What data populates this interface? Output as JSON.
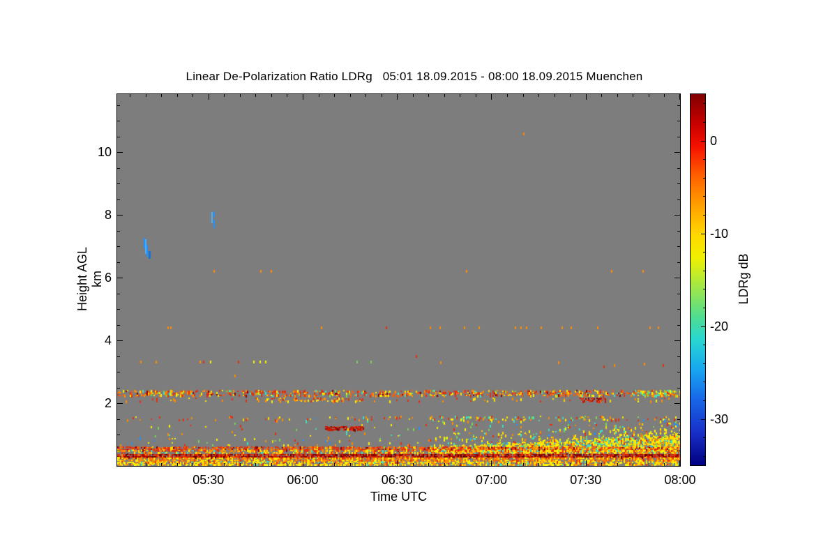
{
  "title": "Linear De-Polarization Ratio LDRg   05:01 18.09.2015 - 08:00 18.09.2015 Muenchen",
  "plot_bg": "#7d7d7d",
  "axes": {
    "x": {
      "label": "Time UTC",
      "start": "05:01",
      "end": "08:00",
      "tick_labels": [
        "05:30",
        "06:00",
        "06:30",
        "07:00",
        "07:30",
        "08:00"
      ],
      "tick_minutes": [
        30,
        60,
        90,
        120,
        150,
        180
      ],
      "minor_step_min": 5
    },
    "y": {
      "label": "Height AGL km",
      "tick_labels": [
        "2",
        "4",
        "6",
        "8",
        "10"
      ],
      "tick_km": [
        2,
        4,
        6,
        8,
        10
      ],
      "minor_step_km": 0.5,
      "range_km": [
        0,
        11.84
      ]
    }
  },
  "colorbar": {
    "label": "LDRg dB",
    "tick_labels": [
      "0",
      "-10",
      "-20",
      "-30"
    ],
    "tick_values": [
      0,
      -10,
      -20,
      -30
    ],
    "minor_step_db": 2,
    "range_db": [
      5,
      -35
    ],
    "gradient": [
      [
        0.0,
        "#800000"
      ],
      [
        0.08,
        "#c80000"
      ],
      [
        0.14,
        "#f51000"
      ],
      [
        0.22,
        "#ff6000"
      ],
      [
        0.3,
        "#ffa000"
      ],
      [
        0.38,
        "#ffd800"
      ],
      [
        0.44,
        "#f0f000"
      ],
      [
        0.52,
        "#a0e848"
      ],
      [
        0.6,
        "#50dc90"
      ],
      [
        0.66,
        "#28d8d0"
      ],
      [
        0.74,
        "#18a8f0"
      ],
      [
        0.82,
        "#1868e8"
      ],
      [
        0.91,
        "#1830c8"
      ],
      [
        1.0,
        "#000080"
      ]
    ]
  },
  "chart_data": {
    "type": "heatmap",
    "title": "Linear De-Polarization Ratio LDRg",
    "site": "Muenchen",
    "time_span": "05:01 18.09.2015 - 08:00 18.09.2015 UTC",
    "x_unit": "minutes after 05:00 UTC",
    "x_range": [
      1,
      180
    ],
    "y_unit": "km AGL",
    "y_range": [
      0,
      11.84
    ],
    "z_unit": "LDRg dB",
    "z_range": [
      5,
      -35
    ],
    "background_means": "no signal (gray)",
    "colors": {
      "o": "#FF8C00",
      "r": "#E03010",
      "y": "#FFF000",
      "g": "#78D850",
      "b": "#1E90FF",
      "lb": "#4FB0F8",
      "mb": "#1273D8"
    },
    "palettes": {
      "aerosol_mix": {
        "#E03010": 0.28,
        "#F26010": 0.18,
        "#FF8C00": 0.18,
        "#FFD700": 0.12,
        "#FFF000": 0.08,
        "#8B0000": 0.05,
        "#40E0C0": 0.06,
        "#78D850": 0.05
      },
      "cool_mix": {
        "#40E0C0": 0.3,
        "#78D850": 0.25,
        "#FFF000": 0.25,
        "#FF8C00": 0.2
      },
      "warm": {
        "#E03010": 0.35,
        "#FF8C00": 0.3,
        "#FFD700": 0.2,
        "#FFF000": 0.15
      },
      "red_dark": {
        "#C81800": 0.5,
        "#8B0000": 0.3,
        "#E03010": 0.2
      },
      "multi": {
        "#FF8C00": 0.22,
        "#E03010": 0.18,
        "#FFF000": 0.2,
        "#78D850": 0.12,
        "#40E0C0": 0.14,
        "#1E90FF": 0.06,
        "#FFD700": 0.08
      },
      "yellow_mix": {
        "#FFF000": 0.34,
        "#FFE000": 0.16,
        "#FFD700": 0.12,
        "#FF8C00": 0.1,
        "#40E0C0": 0.12,
        "#78D850": 0.08,
        "#E03010": 0.05,
        "#20B8E8": 0.03
      },
      "red_band": {
        "#E03010": 0.4,
        "#F26010": 0.25,
        "#FF8C00": 0.2,
        "#8B0000": 0.07,
        "#FFD700": 0.08
      },
      "band_mix": {
        "#FFF000": 0.3,
        "#FF8C00": 0.25,
        "#E03010": 0.2,
        "#FFD700": 0.15,
        "#40E0C0": 0.1
      },
      "dark_red_band": {
        "#8B0000": 0.3,
        "#C81800": 0.3,
        "#E03010": 0.25,
        "#600000": 0.08,
        "#FF8C00": 0.07
      },
      "orange_band": {
        "#FF8C00": 0.35,
        "#F26010": 0.2,
        "#FFF000": 0.22,
        "#FFD700": 0.15,
        "#E03010": 0.08
      },
      "yellow_band": {
        "#FFF000": 0.38,
        "#FFD700": 0.2,
        "#FF8C00": 0.25,
        "#E03010": 0.1,
        "#40E0C0": 0.07
      }
    },
    "features": [
      {
        "kind": "dotline",
        "name": "aerosol layer 2.35 km",
        "t": [
          1,
          180
        ],
        "km": [
          2.27,
          2.42
        ],
        "density": 0.5,
        "palette": "aerosol_mix"
      },
      {
        "kind": "dotline",
        "name": "layer 2.35 km cool-colored tail",
        "t": [
          166,
          180
        ],
        "km": [
          2.27,
          2.42
        ],
        "density": 0.5,
        "palette": "cool_mix"
      },
      {
        "kind": "dotline",
        "name": "layer 2.1 km sparse",
        "t": [
          1,
          180
        ],
        "km": [
          2.07,
          2.18
        ],
        "density": 0.09,
        "palette": "warm"
      },
      {
        "kind": "dotline",
        "name": "layer 2.1 km mid segment",
        "t": [
          50,
          81
        ],
        "km": [
          2.07,
          2.18
        ],
        "density": 0.32,
        "palette": "warm"
      },
      {
        "kind": "dotline",
        "name": "layer 2.1 km red cluster",
        "t": [
          148,
          156
        ],
        "km": [
          2.07,
          2.18
        ],
        "density": 0.6,
        "palette": "red_dark"
      },
      {
        "kind": "dotline",
        "name": "layer 1.5 km sparse",
        "t": [
          1,
          180
        ],
        "km": [
          1.45,
          1.58
        ],
        "density": 0.09,
        "palette": "warm"
      },
      {
        "kind": "dotline",
        "name": "layer 1.5 km right multi",
        "t": [
          100,
          180
        ],
        "km": [
          1.45,
          1.58
        ],
        "density": 0.12,
        "palette": "multi"
      },
      {
        "kind": "dotline",
        "name": "red segment 1.2 km 06:07-06:19",
        "t": [
          67,
          79
        ],
        "km": [
          1.18,
          1.27
        ],
        "density": 0.85,
        "palette": "red_dark"
      },
      {
        "kind": "scatter",
        "name": "sparse specks 0.85-1.6 km early",
        "t": [
          1,
          100
        ],
        "km": [
          0.85,
          1.6
        ],
        "density": 0.022,
        "palette": "multi"
      },
      {
        "kind": "scatter",
        "name": "specks 0.9-1.6 km late",
        "t": [
          100,
          180
        ],
        "km": [
          0.9,
          1.6
        ],
        "density": 0.06,
        "palette": "multi"
      },
      {
        "kind": "scatter",
        "name": "specks 0.6-0.9 km early",
        "t": [
          1,
          100
        ],
        "km": [
          0.62,
          0.9
        ],
        "density": 0.05,
        "palette": "multi"
      },
      {
        "kind": "wedge",
        "name": "growing boundary layer after 06:40",
        "t": [
          100,
          180
        ],
        "km_top": [
          0.6,
          1.02
        ],
        "km_bot": [
          0.45,
          0.5
        ],
        "density": 0.88,
        "palette": "yellow_mix"
      },
      {
        "kind": "wedge",
        "name": "sparse top of growing layer",
        "t": [
          100,
          180
        ],
        "km_top": [
          0.9,
          1.4
        ],
        "km_bot": [
          0.6,
          1.02
        ],
        "density": 0.15,
        "palette": "yellow_mix"
      },
      {
        "kind": "dotline",
        "name": "surface band 0.53-0.62 km red",
        "t": [
          1,
          180
        ],
        "km": [
          0.53,
          0.62
        ],
        "density": 0.8,
        "palette": "red_band"
      },
      {
        "kind": "dotline",
        "name": "surface band 0.40-0.52 km mixed",
        "t": [
          1,
          180
        ],
        "km": [
          0.4,
          0.52
        ],
        "density": 0.45,
        "palette": "band_mix",
        "ramp": [
          1,
          1.6
        ]
      },
      {
        "kind": "dotline",
        "name": "surface band 0.29-0.39 km dark red",
        "t": [
          1,
          180
        ],
        "km": [
          0.29,
          0.39
        ],
        "density": 0.92,
        "palette": "dark_red_band"
      },
      {
        "kind": "dotline",
        "name": "surface band 0.16-0.28 km orange",
        "t": [
          1,
          180
        ],
        "km": [
          0.16,
          0.28
        ],
        "density": 0.85,
        "palette": "orange_band"
      },
      {
        "kind": "dotline",
        "name": "surface band 0.02-0.15 km yellow",
        "t": [
          1,
          180
        ],
        "km": [
          0.02,
          0.15
        ],
        "density": 0.8,
        "palette": "yellow_band"
      },
      {
        "kind": "points",
        "name": "isolated echoes",
        "pts": [
          [
            130,
            10.58,
            "o"
          ],
          [
            31.6,
            6.2,
            "o"
          ],
          [
            46.5,
            6.2,
            "o"
          ],
          [
            49.8,
            6.2,
            "o"
          ],
          [
            111.9,
            6.2,
            "o"
          ],
          [
            158.1,
            6.2,
            "o"
          ],
          [
            168,
            6.2,
            "o"
          ],
          [
            17,
            4.4,
            "o"
          ],
          [
            17.9,
            4.4,
            "o"
          ],
          [
            65.8,
            4.4,
            "o"
          ],
          [
            86.4,
            4.4,
            "r"
          ],
          [
            100.4,
            4.4,
            "o"
          ],
          [
            103.5,
            4.4,
            "o"
          ],
          [
            111.2,
            4.4,
            "o"
          ],
          [
            115.9,
            4.4,
            "o"
          ],
          [
            127.4,
            4.4,
            "o"
          ],
          [
            129.2,
            4.4,
            "o"
          ],
          [
            131,
            4.4,
            "o"
          ],
          [
            135.6,
            4.4,
            "o"
          ],
          [
            142.3,
            4.4,
            "o"
          ],
          [
            145.2,
            4.4,
            "o"
          ],
          [
            153.6,
            4.4,
            "o"
          ],
          [
            170.2,
            4.4,
            "o"
          ],
          [
            172.9,
            4.4,
            "o"
          ],
          [
            8.3,
            3.32,
            "o"
          ],
          [
            13.2,
            3.32,
            "o"
          ],
          [
            27.2,
            3.32,
            "o"
          ],
          [
            28.3,
            3.32,
            "r"
          ],
          [
            30.5,
            3.32,
            "y"
          ],
          [
            39.4,
            3.32,
            "r"
          ],
          [
            44.3,
            3.32,
            "y"
          ],
          [
            46.3,
            3.32,
            "y"
          ],
          [
            48,
            3.32,
            "y"
          ],
          [
            77.1,
            3.32,
            "g"
          ],
          [
            81.5,
            3.32,
            "g"
          ],
          [
            96,
            3.5,
            "r"
          ],
          [
            103.7,
            3.3,
            "o"
          ],
          [
            141.2,
            3.3,
            "o"
          ],
          [
            155.6,
            3.15,
            "r"
          ],
          [
            159,
            3.2,
            "o"
          ],
          [
            168.5,
            3.25,
            "o"
          ],
          [
            174.5,
            3.2,
            "r"
          ],
          [
            38.2,
            2.87,
            "o"
          ]
        ]
      },
      {
        "kind": "rects",
        "name": "falling ice streaks (blue)",
        "rects": [
          [
            9.4,
            9.9,
            6.93,
            7.27,
            "b"
          ],
          [
            9.9,
            10.4,
            6.75,
            7.22,
            "lb"
          ],
          [
            10.4,
            10.9,
            6.67,
            7.05,
            "b"
          ],
          [
            10.9,
            11.5,
            6.6,
            6.85,
            "mb"
          ],
          [
            30.9,
            31.4,
            7.72,
            8.08,
            "lb"
          ],
          [
            31.6,
            32,
            7.95,
            8.12,
            "b"
          ],
          [
            31.6,
            32,
            7.58,
            7.85,
            "b"
          ]
        ]
      }
    ]
  }
}
